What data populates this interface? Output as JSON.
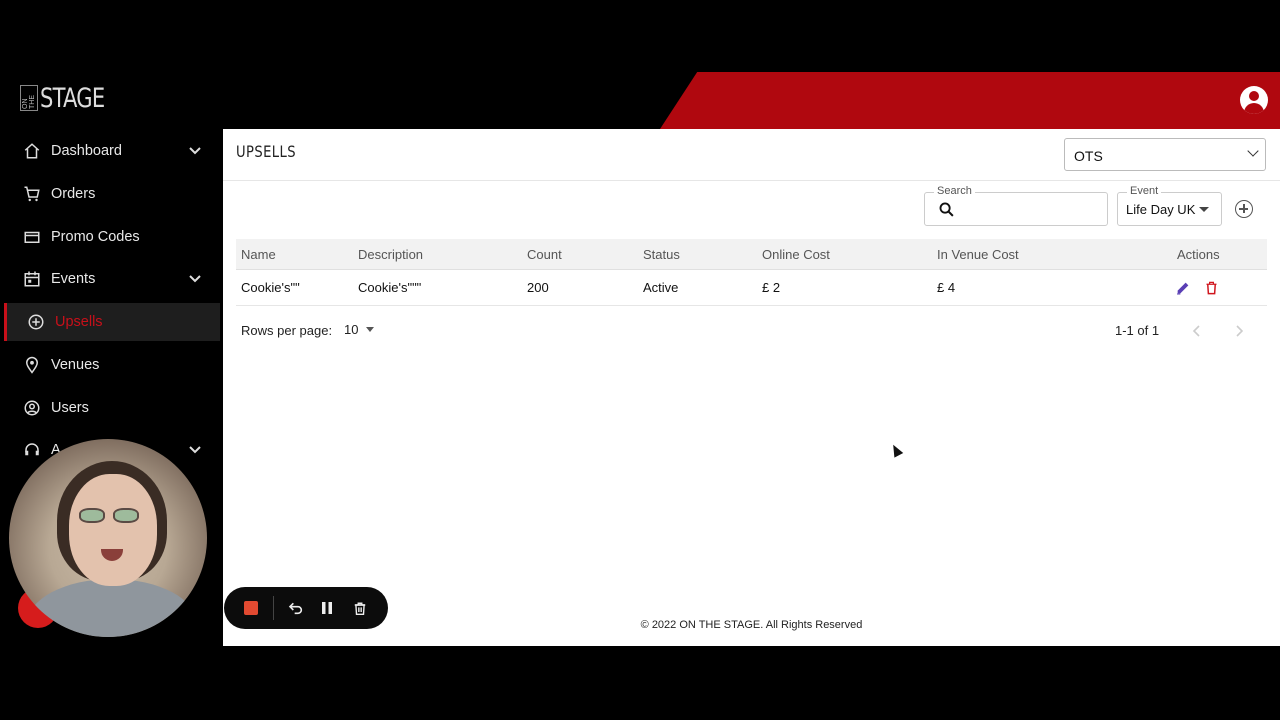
{
  "app": {
    "logo_small": "ON THE",
    "logo_big": "STAGE",
    "colors": {
      "brand_red": "#b0080f",
      "sidebar_bg": "#000000",
      "active_text": "#c8101a"
    }
  },
  "sidebar": {
    "items": [
      {
        "label": "Dashboard",
        "icon": "home-icon",
        "expandable": true
      },
      {
        "label": "Orders",
        "icon": "cart-icon",
        "expandable": false
      },
      {
        "label": "Promo Codes",
        "icon": "ticket-icon",
        "expandable": false
      },
      {
        "label": "Events",
        "icon": "calendar-icon",
        "expandable": true
      },
      {
        "label": "Upsells",
        "icon": "add-circle-icon",
        "expandable": false,
        "active": true
      },
      {
        "label": "Venues",
        "icon": "location-pin-icon",
        "expandable": false
      },
      {
        "label": "Users",
        "icon": "user-circle-icon",
        "expandable": false
      },
      {
        "label": "A",
        "icon": "headset-icon",
        "expandable": true
      }
    ]
  },
  "main": {
    "title": "UPSELLS",
    "venue_select": {
      "value": "OTS"
    },
    "search": {
      "label": "Search",
      "value": ""
    },
    "event": {
      "label": "Event",
      "value": "Life Day UK"
    },
    "table": {
      "columns": [
        "Name",
        "Description",
        "Count",
        "Status",
        "Online Cost",
        "In Venue Cost",
        "Actions"
      ],
      "rows": [
        {
          "name": "Cookie's\"\"",
          "description": "Cookie's\"\"\"",
          "count": "200",
          "status": "Active",
          "online_cost": "£ 2",
          "in_venue_cost": "£ 4"
        }
      ]
    },
    "pagination": {
      "rows_label": "Rows per page:",
      "rows_value": "10",
      "range": "1-1 of 1"
    },
    "footer": "© 2022 ON THE STAGE. All Rights Reserved"
  },
  "recorder": {
    "controls": [
      "stop-icon",
      "undo-icon",
      "pause-icon",
      "trash-icon"
    ]
  }
}
